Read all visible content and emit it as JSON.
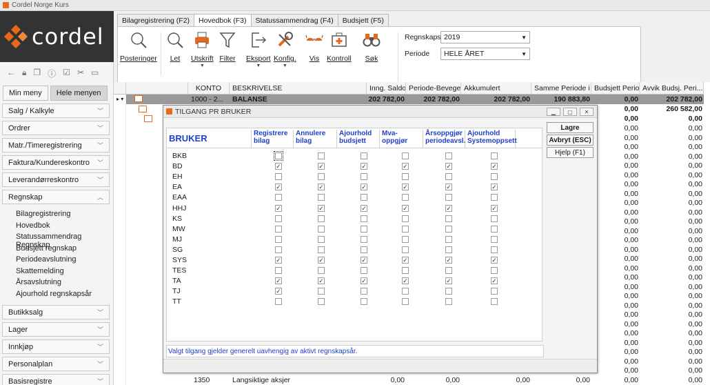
{
  "app": {
    "title": "Cordel Norge Kurs",
    "brand": "cordel"
  },
  "sidebar": {
    "tabs": [
      {
        "label": "Min meny"
      },
      {
        "label": "Hele menyen"
      }
    ],
    "items": [
      {
        "label": "Salg / Kalkyle"
      },
      {
        "label": "Ordrer"
      },
      {
        "label": "Matr./Timeregistrering"
      },
      {
        "label": "Faktura/Kundereskontro"
      },
      {
        "label": "Leverandørreskontro"
      },
      {
        "label": "Regnskap"
      },
      {
        "label": "Butikksalg"
      },
      {
        "label": "Lager"
      },
      {
        "label": "Innkjøp"
      },
      {
        "label": "Personalplan"
      },
      {
        "label": "Basisregistre"
      }
    ],
    "regnskap_sub": [
      "Bilagregistrering",
      "Hovedbok",
      "Statussammendrag Regnskap",
      "Budsjett regnskap",
      "Periodeavslutning",
      "Skattemelding",
      "Årsavslutning",
      "Ajourhold regnskapsår"
    ]
  },
  "tabs": [
    {
      "label": "Bilagregistrering (F2)"
    },
    {
      "label": "Hovedbok (F3)"
    },
    {
      "label": "Statussammendrag (F4)"
    },
    {
      "label": "Budsjett (F5)"
    }
  ],
  "ribbon": {
    "buttons": [
      {
        "label": "Posteringer"
      },
      {
        "label": "Let"
      },
      {
        "label": "Utskrift"
      },
      {
        "label": "Filter"
      },
      {
        "label": "Eksport"
      },
      {
        "label": "Konfig."
      },
      {
        "label": "Vis"
      },
      {
        "label": "Kontroll"
      },
      {
        "label": "Søk"
      }
    ],
    "regnskapsar_label": "Regnskapsår",
    "regnskapsar_value": "2019",
    "periode_label": "Periode",
    "periode_value": "HELE ÅRET"
  },
  "grid": {
    "columns": [
      "KONTO",
      "BESKRIVELSE",
      "Inng. Saldo",
      "Periode-Bevege...",
      "Akkumulert",
      "Samme Periode i ...",
      "Budsjett Perio...",
      "Avvik Budsj. Peri..."
    ],
    "row1": {
      "konto": "1000 - 2...",
      "beskrivelse": "BALANSE",
      "inng": "202 782,00",
      "periode": "202 782,00",
      "akk": "202 782,00",
      "samme": "190 883,80",
      "budsjett": "0,00",
      "avvik": "202 782,00"
    },
    "row2": {
      "budsjett": "0,00",
      "avvik": "260 582,00"
    },
    "row3": {
      "budsjett": "0,00",
      "avvik": "0,00"
    },
    "zero": "0,00",
    "last": {
      "konto": "1350",
      "beskrivelse": "Langsiktige aksjer",
      "inng": "0,00",
      "periode": "0,00",
      "akk": "0,00",
      "samme": "0,00",
      "budsjett": "0,00",
      "avvik": "0,00"
    }
  },
  "dialog": {
    "title": "TILGANG PR BRUKER",
    "bruker_header": "BRUKER",
    "rights": [
      "Registrere bilag",
      "Annulere bilag",
      "Ajourhold budsjett",
      "Mva-oppgjør",
      "Årsoppgjør periodeavsl.",
      "Ajourhold Systemoppsett"
    ],
    "users": [
      {
        "name": "BKB",
        "rights": [
          false,
          false,
          false,
          false,
          false,
          false
        ]
      },
      {
        "name": "BD",
        "rights": [
          true,
          true,
          true,
          true,
          true,
          true
        ]
      },
      {
        "name": "EH",
        "rights": [
          false,
          false,
          false,
          false,
          false,
          false
        ]
      },
      {
        "name": "EA",
        "rights": [
          true,
          true,
          true,
          true,
          true,
          true
        ]
      },
      {
        "name": "EAA",
        "rights": [
          false,
          false,
          false,
          false,
          false,
          false
        ]
      },
      {
        "name": "HHJ",
        "rights": [
          true,
          true,
          true,
          true,
          true,
          true
        ]
      },
      {
        "name": "KS",
        "rights": [
          false,
          false,
          false,
          false,
          false,
          false
        ]
      },
      {
        "name": "MW",
        "rights": [
          false,
          false,
          false,
          false,
          false,
          false
        ]
      },
      {
        "name": "MJ",
        "rights": [
          false,
          false,
          false,
          false,
          false,
          false
        ]
      },
      {
        "name": "SG",
        "rights": [
          false,
          false,
          false,
          false,
          false,
          false
        ]
      },
      {
        "name": "SYS",
        "rights": [
          true,
          true,
          true,
          true,
          true,
          true
        ]
      },
      {
        "name": "TES",
        "rights": [
          false,
          false,
          false,
          false,
          false,
          false
        ]
      },
      {
        "name": "TA",
        "rights": [
          true,
          true,
          true,
          true,
          true,
          true
        ]
      },
      {
        "name": "TJ",
        "rights": [
          true,
          false,
          false,
          false,
          false,
          false
        ]
      },
      {
        "name": "TT",
        "rights": [
          false,
          false,
          false,
          false,
          false,
          false
        ]
      }
    ],
    "buttons": {
      "save": "Lagre",
      "cancel": "Avbryt (ESC)",
      "help": "Hjelp (F1)"
    },
    "note": "Valgt tilgang gjelder generelt uavhengig av aktivt regnskapsår."
  }
}
